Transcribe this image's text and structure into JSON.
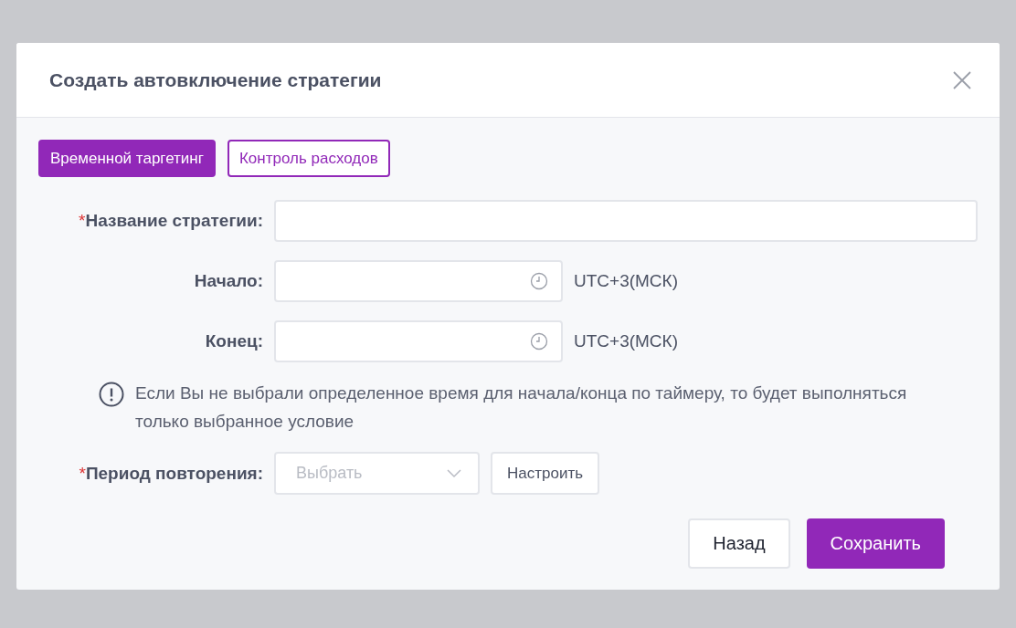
{
  "dialog": {
    "title": "Создать автовключение стратегии"
  },
  "tabs": [
    {
      "label": "Временной таргетинг",
      "selected": true
    },
    {
      "label": "Контроль расходов",
      "selected": false
    }
  ],
  "fields": [
    {
      "kind": "text",
      "label": "Название стратегии:",
      "required_mark": "*"
    },
    {
      "kind": "time",
      "label": "Начало:",
      "suffix": "UTC+3(МСК)"
    },
    {
      "kind": "time",
      "label": "Конец:",
      "suffix": "UTC+3(МСК)"
    },
    {
      "kind": "note",
      "text": "Если Вы не выбрали определенное время для начала/конца по таймеру, то будет выполняться только выбранное условие"
    },
    {
      "kind": "select",
      "label": "Период повторения:",
      "required_mark": "*",
      "placeholder": "Выбрать",
      "button": "Настроить"
    }
  ],
  "footer": {
    "buttons": [
      {
        "label": "Назад",
        "kind": "secondary"
      },
      {
        "label": "Сохранить",
        "kind": "primary"
      }
    ]
  }
}
